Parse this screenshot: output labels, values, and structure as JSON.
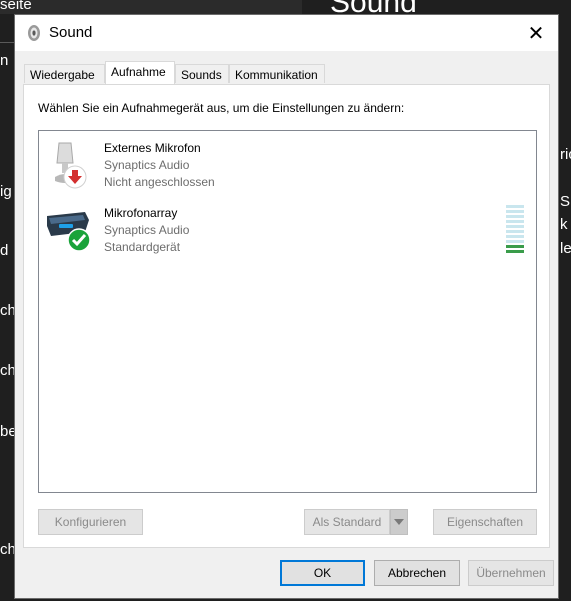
{
  "background": {
    "title": "Sound",
    "top_left_fragment": "seite",
    "left_fragments": [
      "ig",
      "d",
      "ch",
      "ch",
      "be",
      "che"
    ],
    "right_fragments": [
      "ric",
      "S",
      "k",
      "le"
    ]
  },
  "dialog": {
    "title": "Sound",
    "close_glyph": "✕"
  },
  "tabs": [
    {
      "label": "Wiedergabe"
    },
    {
      "label": "Aufnahme"
    },
    {
      "label": "Sounds"
    },
    {
      "label": "Kommunikation"
    }
  ],
  "active_tab": "Aufnahme",
  "instruction": "Wählen Sie ein Aufnahmegerät aus, um die Einstellungen zu ändern:",
  "devices": [
    {
      "name": "Externes Mikrofon",
      "driver": "Synaptics Audio",
      "status": "Nicht angeschlossen",
      "icon": "microphone-icon",
      "badge": "disconnected-arrow-icon"
    },
    {
      "name": "Mikrofonarray",
      "driver": "Synaptics Audio",
      "status": "Standardgerät",
      "icon": "microphone-array-icon",
      "badge": "default-check-icon",
      "level": 0.2
    }
  ],
  "buttons": {
    "configure": "Konfigurieren",
    "set_default": "Als Standard",
    "properties": "Eigenschaften",
    "ok": "OK",
    "cancel": "Abbrechen",
    "apply": "Übernehmen"
  },
  "colors": {
    "accent": "#0078d7",
    "level_on": "#3a9c4a",
    "level_off": "#c9e6ee",
    "disconnected": "#d32f2f",
    "default_badge": "#1aa33a"
  }
}
